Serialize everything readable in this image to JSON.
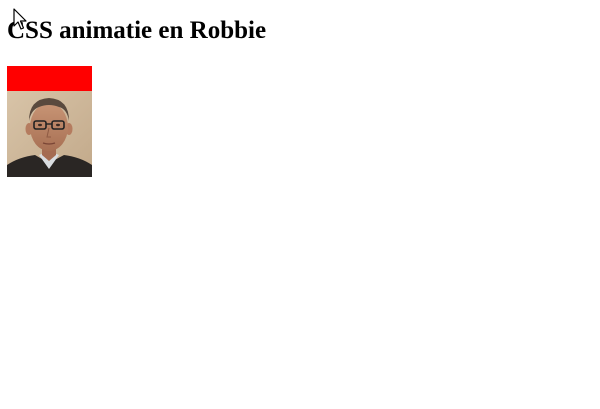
{
  "page": {
    "title": "CSS animatie en Robbie"
  },
  "animated_box": {
    "color": "#ff0000"
  },
  "photo": {
    "alt": "Robbie"
  },
  "colors": {
    "background": "#ffffff",
    "text": "#000000"
  }
}
